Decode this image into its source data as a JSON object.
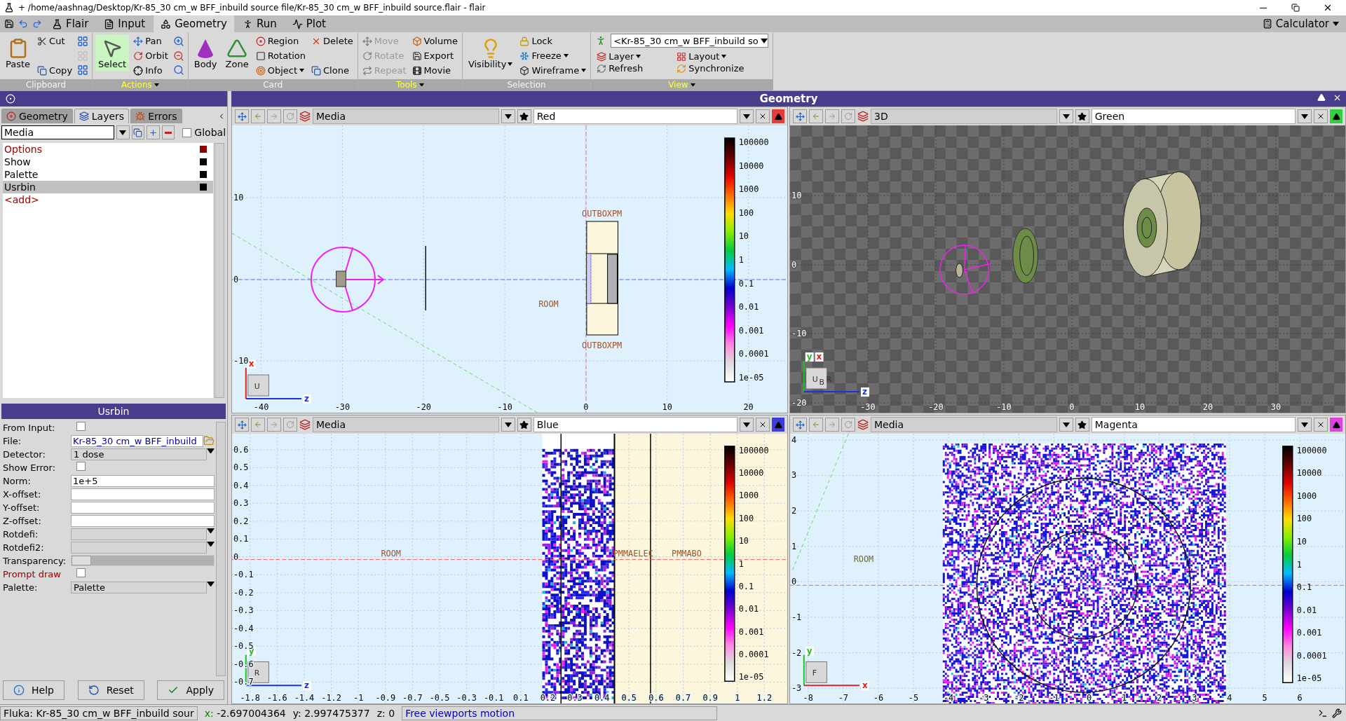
{
  "window": {
    "title": "+ /home/aashnag/Desktop/Kr-85_30 cm_w BFF_inbuild source file/Kr-85_30 cm_w BFF_inbuild source.flair - flair"
  },
  "menu_tabs": [
    {
      "label": "Flair",
      "selected": false
    },
    {
      "label": "Input",
      "selected": false
    },
    {
      "label": "Geometry",
      "selected": true
    },
    {
      "label": "Run",
      "selected": false
    },
    {
      "label": "Plot",
      "selected": false
    }
  ],
  "calculator": {
    "label": "Calculator"
  },
  "ribbon": [
    {
      "title": "Clipboard",
      "menu": false,
      "kind": "buttons",
      "columns": [
        [
          {
            "label": "Paste",
            "kind": "big",
            "disabled": false,
            "dropdown": false
          }
        ],
        [
          {
            "label": "Cut",
            "kind": "small",
            "disabled": false,
            "dropdown": false
          },
          {
            "label": "Copy",
            "kind": "small",
            "disabled": false,
            "dropdown": false
          }
        ],
        [
          {
            "kind": "icon",
            "disabled": false
          },
          {
            "kind": "icon",
            "disabled": true
          },
          {
            "kind": "icon",
            "disabled": false
          }
        ]
      ]
    },
    {
      "title": "Actions",
      "menu": true,
      "kind": "buttons",
      "columns": [
        [
          {
            "label": "Select",
            "kind": "big",
            "disabled": false,
            "dropdown": false,
            "selected": true
          }
        ],
        [
          {
            "label": "Pan",
            "kind": "small",
            "disabled": false,
            "dropdown": false,
            "selected": false
          },
          {
            "label": "Orbit",
            "kind": "small",
            "disabled": false,
            "dropdown": false,
            "selected": false
          },
          {
            "label": "Info",
            "kind": "small",
            "disabled": false,
            "dropdown": false,
            "selected": false
          }
        ],
        [
          {
            "kind": "icon",
            "disabled": false,
            "selected": false
          },
          {
            "kind": "icon",
            "disabled": false,
            "selected": false
          },
          {
            "kind": "icon",
            "disabled": false,
            "selected": false
          }
        ]
      ]
    },
    {
      "title": "Card",
      "menu": false,
      "kind": "buttons",
      "columns": [
        [
          {
            "label": "Body",
            "kind": "big",
            "disabled": false,
            "dropdown": false
          }
        ],
        [
          {
            "label": "Zone",
            "kind": "big",
            "disabled": false,
            "dropdown": false
          }
        ],
        [
          {
            "label": "Region",
            "kind": "small",
            "disabled": false,
            "dropdown": false
          },
          {
            "label": "Rotation",
            "kind": "small",
            "disabled": false,
            "dropdown": false
          },
          {
            "label": "Object",
            "kind": "small",
            "disabled": false,
            "dropdown": true
          }
        ],
        [
          {
            "label": "Delete",
            "kind": "small",
            "disabled": false,
            "dropdown": false
          },
          {
            "label": "Clone",
            "kind": "small",
            "disabled": false,
            "dropdown": false
          }
        ]
      ]
    },
    {
      "title": "Tools",
      "menu": true,
      "kind": "buttons",
      "columns": [
        [
          {
            "label": "Move",
            "kind": "small",
            "disabled": true,
            "dropdown": false
          },
          {
            "label": "Rotate",
            "kind": "small",
            "disabled": true,
            "dropdown": false
          },
          {
            "label": "Repeat",
            "kind": "small",
            "disabled": true,
            "dropdown": false
          }
        ],
        [
          {
            "label": "Volume",
            "kind": "small",
            "disabled": false,
            "dropdown": false
          },
          {
            "label": "Export",
            "kind": "small",
            "disabled": false,
            "dropdown": false
          },
          {
            "label": "Movie",
            "kind": "small",
            "disabled": false,
            "dropdown": false
          }
        ]
      ]
    },
    {
      "title": "Selection",
      "menu": false,
      "kind": "buttons",
      "columns": [
        [
          {
            "label": "Visibility",
            "kind": "big",
            "disabled": false,
            "dropdown": true
          }
        ],
        [
          {
            "label": "Lock",
            "kind": "small",
            "disabled": false,
            "dropdown": false
          },
          {
            "label": "Freeze",
            "kind": "small",
            "disabled": false,
            "dropdown": true
          },
          {
            "label": "Wireframe",
            "kind": "small",
            "disabled": false,
            "dropdown": true
          }
        ]
      ]
    },
    {
      "title": "View",
      "menu": true,
      "kind": "view",
      "combo": "<Kr-85_30 cm_w BFF_inbuild so",
      "columns": [
        [
          {
            "label": "Layer",
            "kind": "small",
            "disabled": false,
            "dropdown": true
          },
          {
            "label": "Refresh",
            "kind": "small",
            "disabled": false,
            "dropdown": false
          }
        ],
        [
          {
            "label": "Layout",
            "kind": "small",
            "disabled": false,
            "dropdown": true
          },
          {
            "label": "Synchronize",
            "kind": "small",
            "disabled": false,
            "dropdown": false
          }
        ]
      ]
    }
  ],
  "left_panel": {
    "tabs": [
      {
        "label": "Geometry",
        "selected": false
      },
      {
        "label": "Layers",
        "selected": true
      },
      {
        "label": "Errors",
        "selected": false
      }
    ],
    "layer_combo": {
      "value": "Media"
    },
    "global": {
      "label": "Global",
      "checked": false
    },
    "layers": [
      {
        "label": "Options",
        "kind": "options",
        "color": "#8b0000",
        "selected": false
      },
      {
        "label": "Show",
        "kind": "layer",
        "color": "#000000",
        "selected": false
      },
      {
        "label": "Palette",
        "kind": "layer",
        "color": "#000000",
        "selected": false
      },
      {
        "label": "Usrbin",
        "kind": "layer",
        "color": "#000000",
        "selected": true
      },
      {
        "label": "<add>",
        "kind": "add",
        "selected": false
      }
    ],
    "form": {
      "title": "Usrbin",
      "fields": [
        {
          "label": "From Input:",
          "kind": "checkbox",
          "checked": false,
          "highlighted": false
        },
        {
          "label": "File:",
          "kind": "file",
          "value": "Kr-85_30 cm_w BFF_inbuild",
          "highlighted": false
        },
        {
          "label": "Detector:",
          "kind": "combo",
          "value": "1 dose",
          "highlighted": false
        },
        {
          "label": "Show Error:",
          "kind": "checkbox",
          "checked": false,
          "highlighted": false
        },
        {
          "label": "Norm:",
          "kind": "text",
          "value": "1e+5",
          "highlighted": false
        },
        {
          "label": "X-offset:",
          "kind": "text",
          "highlighted": false
        },
        {
          "label": "Y-offset:",
          "kind": "text",
          "highlighted": false
        },
        {
          "label": "Z-offset:",
          "kind": "text",
          "highlighted": false
        },
        {
          "label": "Rotdefi:",
          "kind": "combo",
          "highlighted": false
        },
        {
          "label": "Rotdefi2:",
          "kind": "combo",
          "highlighted": false
        },
        {
          "label": "Transparency:",
          "kind": "slider",
          "level": 0,
          "highlighted": false
        },
        {
          "label": "Prompt draw",
          "kind": "checkbox",
          "checked": false,
          "highlighted": true
        },
        {
          "label": "Palette:",
          "kind": "combo",
          "value": "Palette",
          "highlighted": false
        }
      ]
    },
    "buttons": [
      {
        "label": "Help",
        "kind": "help"
      },
      {
        "label": "Reset",
        "kind": "reset"
      },
      {
        "label": "Apply",
        "kind": "apply"
      }
    ]
  },
  "geometry": {
    "title": "Geometry",
    "viewports": [
      {
        "kind": "xz",
        "layer": "Media",
        "color_name": "Red",
        "color": "#e83c3c",
        "x_ticks": [
          "-40",
          "-30",
          "-20",
          "-10",
          "0",
          "10",
          "20"
        ],
        "y_ticks": [
          "10",
          "0",
          "-10"
        ],
        "colorbar": [
          "100000",
          "10000",
          "1000",
          "100",
          "10",
          "1",
          "0.1",
          "0.01",
          "0.001",
          "0.0001",
          "1e-05"
        ],
        "labels": [
          "OUTBOXPM",
          "OUTBOXPM",
          "ROOM"
        ],
        "cube": [
          "U"
        ],
        "axes": [
          {
            "label": "x",
            "color": "#e02020"
          },
          {
            "label": "z",
            "color": "#2030e0"
          }
        ]
      },
      {
        "kind": "perspective",
        "layer": "3D",
        "color_name": "Green",
        "color": "#30d040",
        "x_ticks": [
          "-30",
          "-20",
          "-10",
          "0",
          "10",
          "20",
          "30"
        ],
        "y_ticks": [
          "10",
          "0",
          "-10",
          "-20"
        ],
        "cube": [
          "U",
          "B",
          "R"
        ],
        "axes": [
          {
            "label": "y",
            "color": "#20c020"
          },
          {
            "label": "x",
            "color": "#e02020"
          },
          {
            "label": "z",
            "color": "#2030e0"
          }
        ]
      },
      {
        "kind": "zoom",
        "layer": "Media",
        "color_name": "Blue",
        "color": "#3c3ce0",
        "x_ticks": [
          "-1.8",
          "-1.6",
          "-1.4",
          "-1.2",
          "-1",
          "-0.9",
          "-0.7",
          "-0.5",
          "-0.3",
          "-0.1",
          "0.1",
          "0.2",
          "0.3",
          "0.4",
          "0.5",
          "0.6",
          "0.7",
          "0.9",
          "1",
          "1.2"
        ],
        "y_ticks": [
          "0.6",
          "0.5",
          "0.4",
          "0.3",
          "0.2",
          "0.1",
          "0",
          "-0.1",
          "-0.2",
          "-0.3",
          "-0.4",
          "-0.5",
          "-0.6",
          "-0.7"
        ],
        "colorbar": [
          "100000",
          "10000",
          "1000",
          "100",
          "10",
          "1",
          "0.1",
          "0.01",
          "0.001",
          "0.0001",
          "1e-05"
        ],
        "labels": [
          "ROOM",
          "PMMAELEC",
          "PMMABO"
        ],
        "cube": [
          "R"
        ],
        "axes": [
          {
            "label": "y",
            "color": "#20c020"
          },
          {
            "label": "z",
            "color": "#2030e0"
          }
        ]
      },
      {
        "kind": "xy",
        "layer": "Media",
        "color_name": "Magenta",
        "color": "#e040e0",
        "x_ticks": [
          "-8",
          "-7",
          "-6",
          "-5",
          "-4",
          "-3",
          "-2",
          "-1",
          "0",
          "1",
          "2",
          "3",
          "4",
          "5",
          "6"
        ],
        "y_ticks": [
          "4",
          "3",
          "2",
          "1",
          "0",
          "-1",
          "-2",
          "-3"
        ],
        "colorbar": [
          "100000",
          "10000",
          "1000",
          "100",
          "10",
          "1",
          "0.1",
          "0.01",
          "0.001",
          "0.0001",
          "1e-05"
        ],
        "labels": [
          "ROOM"
        ],
        "cube": [
          "F"
        ],
        "axes": [
          {
            "label": "y",
            "color": "#20c020"
          },
          {
            "label": "x",
            "color": "#e02020"
          }
        ]
      }
    ]
  },
  "status_bar": {
    "file": "Fluka: Kr-85_30 cm_w BFF_inbuild sour",
    "coords": [
      {
        "label": "x:",
        "value": "-2.697004364"
      },
      {
        "label": "y:",
        "value": "2.997475377"
      },
      {
        "label": "z:",
        "value": "0"
      }
    ],
    "mode": "Free viewports motion"
  }
}
